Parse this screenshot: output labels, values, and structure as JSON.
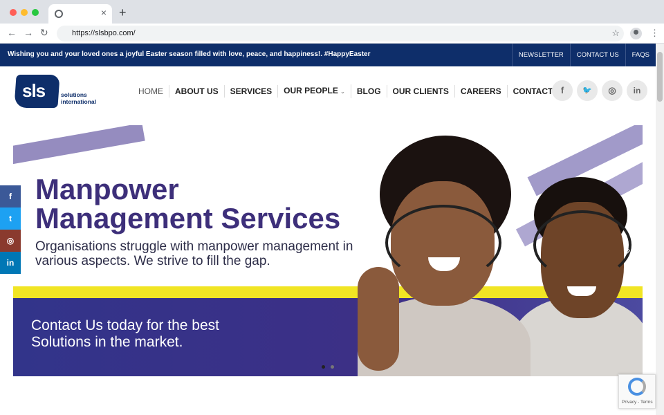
{
  "browser": {
    "url": "https://slsbpo.com/",
    "tab_close": "×",
    "new_tab": "+",
    "back_icon": "←",
    "forward_icon": "→",
    "reload_icon": "↻",
    "star_icon": "☆",
    "menu_icon": "⋮"
  },
  "announcement": {
    "message": "Wishing you and your loved ones a joyful Easter season filled with love, peace, and happiness!. #HappyEaster",
    "links": [
      "NEWSLETTER",
      "CONTACT US",
      "FAQS"
    ]
  },
  "logo": {
    "mark": "sls",
    "line1": "solutions",
    "line2": "international"
  },
  "nav": {
    "items": [
      "HOME",
      "ABOUT US",
      "SERVICES",
      "OUR PEOPLE",
      "BLOG",
      "OUR CLIENTS",
      "CAREERS",
      "CONTACT US"
    ],
    "dropdown_caret": "⌄"
  },
  "social": {
    "facebook": "f",
    "twitter": "🐦",
    "instagram": "◎",
    "linkedin": "in"
  },
  "side_share": {
    "facebook": "f",
    "twitter": "t",
    "instagram": "◎",
    "linkedin": "in"
  },
  "hero": {
    "title_line1": "Manpower",
    "title_line2": "Management Services",
    "subtitle": "Organisations struggle with manpower management in various aspects. We strive to fill the gap.",
    "cta": "Contact Us today for the best Solutions in the market.",
    "prev_icon": "‹",
    "next_icon": "›"
  },
  "recaptcha": {
    "text": "Privacy - Terms"
  },
  "colors": {
    "brand_navy": "#0e2e6a",
    "hero_purple": "#3d2f7a",
    "accent_yellow": "#f1e524",
    "facebook": "#3b5998",
    "twitter": "#1da1f2",
    "instagram": "#8a3a2e",
    "linkedin": "#0077b5"
  }
}
